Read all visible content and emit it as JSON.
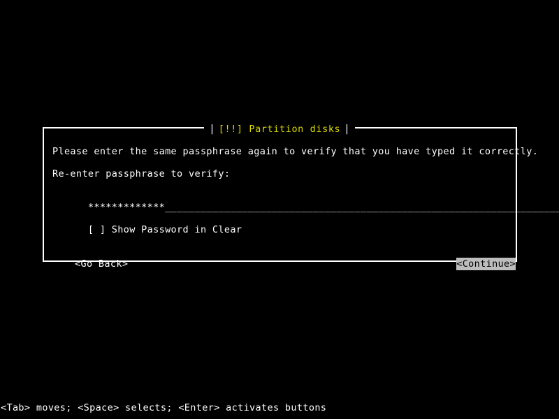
{
  "screen": {
    "background_color": "#000000",
    "foreground_color": "#ffffff"
  },
  "dialog": {
    "title_text": "[!!] Partition disks",
    "title_color": "#d8d800",
    "title_left_separator": "|",
    "title_right_separator": "|",
    "border_color": "#ffffff",
    "prompt": "Please enter the same passphrase again to verify that you have typed it correctly.",
    "field_label": "Re-enter passphrase to verify:",
    "password_field": {
      "masked_value": "*************",
      "mask_character": "*",
      "masked_length": 13,
      "fill_character": "_",
      "fill_line": "_________________________________________________________________________",
      "full_line": "*************_________________________________________________________________________"
    },
    "checkbox": {
      "marker": "[ ]",
      "checked": false,
      "label": "Show Password in Clear",
      "full_text": "[ ] Show Password in Clear"
    },
    "buttons": [
      {
        "label": "<Go Back>",
        "selected": false,
        "text_color": "#ffffff",
        "background_color": "#000000"
      },
      {
        "label": "<Continue>",
        "selected": true,
        "text_color": "#000000",
        "background_color": "#bdbdbd"
      }
    ]
  },
  "help_bar": {
    "text": "<Tab> moves; <Space> selects; <Enter> activates buttons"
  }
}
